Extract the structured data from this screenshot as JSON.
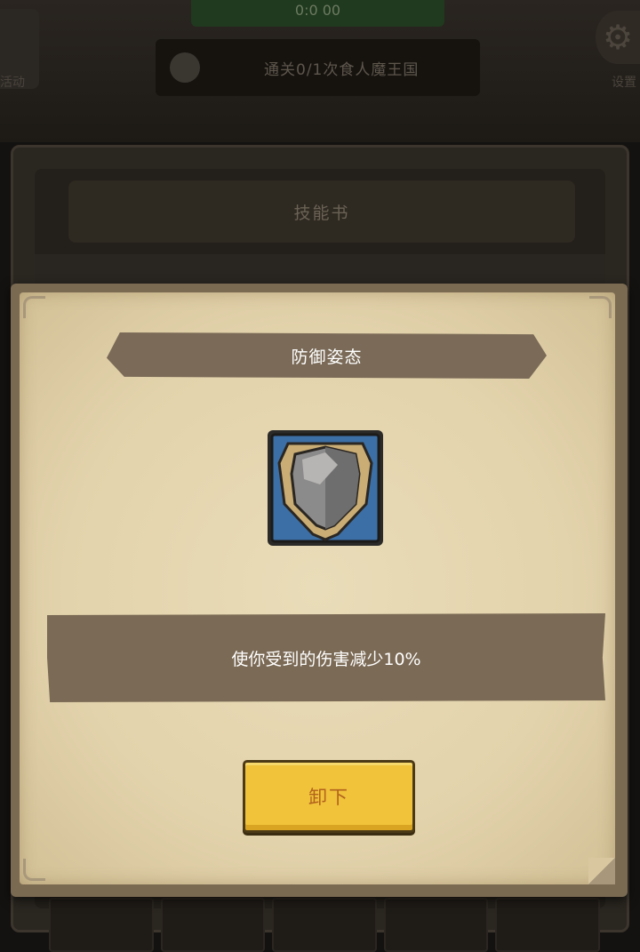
{
  "background": {
    "timer_text": "0:0 00",
    "quest_text": "通关0/1次食人魔王国",
    "left_label": "活动",
    "right_label": "设置",
    "panel_title": "技能书"
  },
  "dialog": {
    "skill_name": "防御姿态",
    "skill_icon": "shield-icon",
    "description": "使你受到的伤害减少10%",
    "unequip_label": "卸下"
  },
  "colors": {
    "parchment": "#e6d8b3",
    "banner": "#7a6a57",
    "button": "#f0c33a",
    "button_text": "#b2621c",
    "icon_frame_blue": "#3c6fa5"
  }
}
